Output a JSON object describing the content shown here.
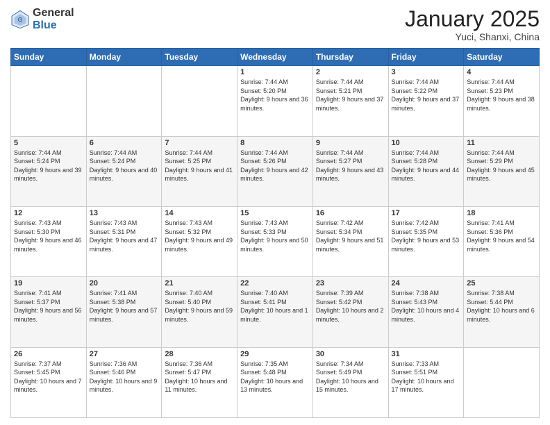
{
  "header": {
    "logo_general": "General",
    "logo_blue": "Blue",
    "month_title": "January 2025",
    "location": "Yuci, Shanxi, China"
  },
  "weekdays": [
    "Sunday",
    "Monday",
    "Tuesday",
    "Wednesday",
    "Thursday",
    "Friday",
    "Saturday"
  ],
  "weeks": [
    [
      {
        "day": "",
        "text": ""
      },
      {
        "day": "",
        "text": ""
      },
      {
        "day": "",
        "text": ""
      },
      {
        "day": "1",
        "text": "Sunrise: 7:44 AM\nSunset: 5:20 PM\nDaylight: 9 hours and 36 minutes."
      },
      {
        "day": "2",
        "text": "Sunrise: 7:44 AM\nSunset: 5:21 PM\nDaylight: 9 hours and 37 minutes."
      },
      {
        "day": "3",
        "text": "Sunrise: 7:44 AM\nSunset: 5:22 PM\nDaylight: 9 hours and 37 minutes."
      },
      {
        "day": "4",
        "text": "Sunrise: 7:44 AM\nSunset: 5:23 PM\nDaylight: 9 hours and 38 minutes."
      }
    ],
    [
      {
        "day": "5",
        "text": "Sunrise: 7:44 AM\nSunset: 5:24 PM\nDaylight: 9 hours and 39 minutes."
      },
      {
        "day": "6",
        "text": "Sunrise: 7:44 AM\nSunset: 5:24 PM\nDaylight: 9 hours and 40 minutes."
      },
      {
        "day": "7",
        "text": "Sunrise: 7:44 AM\nSunset: 5:25 PM\nDaylight: 9 hours and 41 minutes."
      },
      {
        "day": "8",
        "text": "Sunrise: 7:44 AM\nSunset: 5:26 PM\nDaylight: 9 hours and 42 minutes."
      },
      {
        "day": "9",
        "text": "Sunrise: 7:44 AM\nSunset: 5:27 PM\nDaylight: 9 hours and 43 minutes."
      },
      {
        "day": "10",
        "text": "Sunrise: 7:44 AM\nSunset: 5:28 PM\nDaylight: 9 hours and 44 minutes."
      },
      {
        "day": "11",
        "text": "Sunrise: 7:44 AM\nSunset: 5:29 PM\nDaylight: 9 hours and 45 minutes."
      }
    ],
    [
      {
        "day": "12",
        "text": "Sunrise: 7:43 AM\nSunset: 5:30 PM\nDaylight: 9 hours and 46 minutes."
      },
      {
        "day": "13",
        "text": "Sunrise: 7:43 AM\nSunset: 5:31 PM\nDaylight: 9 hours and 47 minutes."
      },
      {
        "day": "14",
        "text": "Sunrise: 7:43 AM\nSunset: 5:32 PM\nDaylight: 9 hours and 49 minutes."
      },
      {
        "day": "15",
        "text": "Sunrise: 7:43 AM\nSunset: 5:33 PM\nDaylight: 9 hours and 50 minutes."
      },
      {
        "day": "16",
        "text": "Sunrise: 7:42 AM\nSunset: 5:34 PM\nDaylight: 9 hours and 51 minutes."
      },
      {
        "day": "17",
        "text": "Sunrise: 7:42 AM\nSunset: 5:35 PM\nDaylight: 9 hours and 53 minutes."
      },
      {
        "day": "18",
        "text": "Sunrise: 7:41 AM\nSunset: 5:36 PM\nDaylight: 9 hours and 54 minutes."
      }
    ],
    [
      {
        "day": "19",
        "text": "Sunrise: 7:41 AM\nSunset: 5:37 PM\nDaylight: 9 hours and 56 minutes."
      },
      {
        "day": "20",
        "text": "Sunrise: 7:41 AM\nSunset: 5:38 PM\nDaylight: 9 hours and 57 minutes."
      },
      {
        "day": "21",
        "text": "Sunrise: 7:40 AM\nSunset: 5:40 PM\nDaylight: 9 hours and 59 minutes."
      },
      {
        "day": "22",
        "text": "Sunrise: 7:40 AM\nSunset: 5:41 PM\nDaylight: 10 hours and 1 minute."
      },
      {
        "day": "23",
        "text": "Sunrise: 7:39 AM\nSunset: 5:42 PM\nDaylight: 10 hours and 2 minutes."
      },
      {
        "day": "24",
        "text": "Sunrise: 7:38 AM\nSunset: 5:43 PM\nDaylight: 10 hours and 4 minutes."
      },
      {
        "day": "25",
        "text": "Sunrise: 7:38 AM\nSunset: 5:44 PM\nDaylight: 10 hours and 6 minutes."
      }
    ],
    [
      {
        "day": "26",
        "text": "Sunrise: 7:37 AM\nSunset: 5:45 PM\nDaylight: 10 hours and 7 minutes."
      },
      {
        "day": "27",
        "text": "Sunrise: 7:36 AM\nSunset: 5:46 PM\nDaylight: 10 hours and 9 minutes."
      },
      {
        "day": "28",
        "text": "Sunrise: 7:36 AM\nSunset: 5:47 PM\nDaylight: 10 hours and 11 minutes."
      },
      {
        "day": "29",
        "text": "Sunrise: 7:35 AM\nSunset: 5:48 PM\nDaylight: 10 hours and 13 minutes."
      },
      {
        "day": "30",
        "text": "Sunrise: 7:34 AM\nSunset: 5:49 PM\nDaylight: 10 hours and 15 minutes."
      },
      {
        "day": "31",
        "text": "Sunrise: 7:33 AM\nSunset: 5:51 PM\nDaylight: 10 hours and 17 minutes."
      },
      {
        "day": "",
        "text": ""
      }
    ]
  ]
}
